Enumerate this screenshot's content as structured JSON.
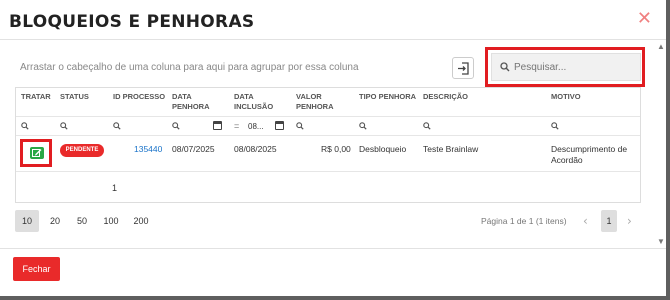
{
  "modal": {
    "title": "BLOQUEIOS E PENHORAS",
    "close_label": "✕",
    "group_hint": "Arrastar o cabeçalho de uma coluna para aqui para agrupar por essa coluna",
    "search_placeholder": "Pesquisar..."
  },
  "grid": {
    "columns": [
      {
        "l1": "TRATAR",
        "l2": ""
      },
      {
        "l1": "STATUS",
        "l2": ""
      },
      {
        "l1": "ID PROCESSO",
        "l2": ""
      },
      {
        "l1": "DATA",
        "l2": "PENHORA"
      },
      {
        "l1": "DATA",
        "l2": "INCLUSÃO"
      },
      {
        "l1": "VALOR",
        "l2": "PENHORA"
      },
      {
        "l1": "TIPO PENHORA",
        "l2": ""
      },
      {
        "l1": "DESCRIÇÃO",
        "l2": ""
      },
      {
        "l1": "MOTIVO",
        "l2": ""
      }
    ],
    "filter_inclusao_value": "08...",
    "filter_eq": "=",
    "rows": [
      {
        "status": "PENDENTE",
        "id_processo": "135440",
        "data_penhora": "08/07/2025",
        "data_inclusao": "08/08/2025",
        "valor_penhora": "R$ 0,00",
        "tipo_penhora": "Desbloqueio",
        "descricao": "Teste Brainlaw",
        "motivo_l1": "Descumprimento de",
        "motivo_l2": "Acordão"
      }
    ],
    "total_count": "1"
  },
  "pager": {
    "sizes": [
      "10",
      "20",
      "50",
      "100",
      "200"
    ],
    "selected_size": "10",
    "info": "Página 1 de 1 (1 itens)",
    "current_page": "1",
    "prev": "‹",
    "next": "›"
  },
  "footer": {
    "close_button": "Fechar"
  },
  "colors": {
    "accent_red": "#e92a2a",
    "highlight_red": "#e11d21",
    "edit_green": "#28a745",
    "link_blue": "#1a73c9"
  }
}
